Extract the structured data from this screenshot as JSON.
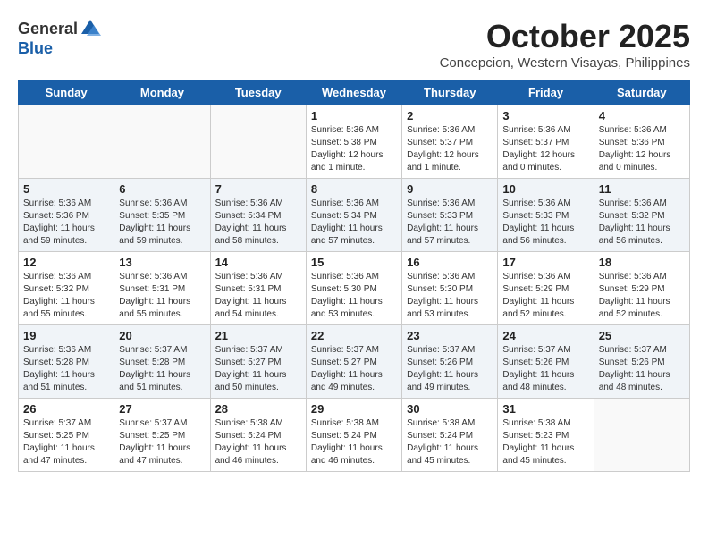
{
  "logo": {
    "general": "General",
    "blue": "Blue"
  },
  "title": "October 2025",
  "subtitle": "Concepcion, Western Visayas, Philippines",
  "headers": [
    "Sunday",
    "Monday",
    "Tuesday",
    "Wednesday",
    "Thursday",
    "Friday",
    "Saturday"
  ],
  "weeks": [
    {
      "shaded": false,
      "days": [
        {
          "number": "",
          "info": ""
        },
        {
          "number": "",
          "info": ""
        },
        {
          "number": "",
          "info": ""
        },
        {
          "number": "1",
          "info": "Sunrise: 5:36 AM\nSunset: 5:38 PM\nDaylight: 12 hours\nand 1 minute."
        },
        {
          "number": "2",
          "info": "Sunrise: 5:36 AM\nSunset: 5:37 PM\nDaylight: 12 hours\nand 1 minute."
        },
        {
          "number": "3",
          "info": "Sunrise: 5:36 AM\nSunset: 5:37 PM\nDaylight: 12 hours\nand 0 minutes."
        },
        {
          "number": "4",
          "info": "Sunrise: 5:36 AM\nSunset: 5:36 PM\nDaylight: 12 hours\nand 0 minutes."
        }
      ]
    },
    {
      "shaded": true,
      "days": [
        {
          "number": "5",
          "info": "Sunrise: 5:36 AM\nSunset: 5:36 PM\nDaylight: 11 hours\nand 59 minutes."
        },
        {
          "number": "6",
          "info": "Sunrise: 5:36 AM\nSunset: 5:35 PM\nDaylight: 11 hours\nand 59 minutes."
        },
        {
          "number": "7",
          "info": "Sunrise: 5:36 AM\nSunset: 5:34 PM\nDaylight: 11 hours\nand 58 minutes."
        },
        {
          "number": "8",
          "info": "Sunrise: 5:36 AM\nSunset: 5:34 PM\nDaylight: 11 hours\nand 57 minutes."
        },
        {
          "number": "9",
          "info": "Sunrise: 5:36 AM\nSunset: 5:33 PM\nDaylight: 11 hours\nand 57 minutes."
        },
        {
          "number": "10",
          "info": "Sunrise: 5:36 AM\nSunset: 5:33 PM\nDaylight: 11 hours\nand 56 minutes."
        },
        {
          "number": "11",
          "info": "Sunrise: 5:36 AM\nSunset: 5:32 PM\nDaylight: 11 hours\nand 56 minutes."
        }
      ]
    },
    {
      "shaded": false,
      "days": [
        {
          "number": "12",
          "info": "Sunrise: 5:36 AM\nSunset: 5:32 PM\nDaylight: 11 hours\nand 55 minutes."
        },
        {
          "number": "13",
          "info": "Sunrise: 5:36 AM\nSunset: 5:31 PM\nDaylight: 11 hours\nand 55 minutes."
        },
        {
          "number": "14",
          "info": "Sunrise: 5:36 AM\nSunset: 5:31 PM\nDaylight: 11 hours\nand 54 minutes."
        },
        {
          "number": "15",
          "info": "Sunrise: 5:36 AM\nSunset: 5:30 PM\nDaylight: 11 hours\nand 53 minutes."
        },
        {
          "number": "16",
          "info": "Sunrise: 5:36 AM\nSunset: 5:30 PM\nDaylight: 11 hours\nand 53 minutes."
        },
        {
          "number": "17",
          "info": "Sunrise: 5:36 AM\nSunset: 5:29 PM\nDaylight: 11 hours\nand 52 minutes."
        },
        {
          "number": "18",
          "info": "Sunrise: 5:36 AM\nSunset: 5:29 PM\nDaylight: 11 hours\nand 52 minutes."
        }
      ]
    },
    {
      "shaded": true,
      "days": [
        {
          "number": "19",
          "info": "Sunrise: 5:36 AM\nSunset: 5:28 PM\nDaylight: 11 hours\nand 51 minutes."
        },
        {
          "number": "20",
          "info": "Sunrise: 5:37 AM\nSunset: 5:28 PM\nDaylight: 11 hours\nand 51 minutes."
        },
        {
          "number": "21",
          "info": "Sunrise: 5:37 AM\nSunset: 5:27 PM\nDaylight: 11 hours\nand 50 minutes."
        },
        {
          "number": "22",
          "info": "Sunrise: 5:37 AM\nSunset: 5:27 PM\nDaylight: 11 hours\nand 49 minutes."
        },
        {
          "number": "23",
          "info": "Sunrise: 5:37 AM\nSunset: 5:26 PM\nDaylight: 11 hours\nand 49 minutes."
        },
        {
          "number": "24",
          "info": "Sunrise: 5:37 AM\nSunset: 5:26 PM\nDaylight: 11 hours\nand 48 minutes."
        },
        {
          "number": "25",
          "info": "Sunrise: 5:37 AM\nSunset: 5:26 PM\nDaylight: 11 hours\nand 48 minutes."
        }
      ]
    },
    {
      "shaded": false,
      "days": [
        {
          "number": "26",
          "info": "Sunrise: 5:37 AM\nSunset: 5:25 PM\nDaylight: 11 hours\nand 47 minutes."
        },
        {
          "number": "27",
          "info": "Sunrise: 5:37 AM\nSunset: 5:25 PM\nDaylight: 11 hours\nand 47 minutes."
        },
        {
          "number": "28",
          "info": "Sunrise: 5:38 AM\nSunset: 5:24 PM\nDaylight: 11 hours\nand 46 minutes."
        },
        {
          "number": "29",
          "info": "Sunrise: 5:38 AM\nSunset: 5:24 PM\nDaylight: 11 hours\nand 46 minutes."
        },
        {
          "number": "30",
          "info": "Sunrise: 5:38 AM\nSunset: 5:24 PM\nDaylight: 11 hours\nand 45 minutes."
        },
        {
          "number": "31",
          "info": "Sunrise: 5:38 AM\nSunset: 5:23 PM\nDaylight: 11 hours\nand 45 minutes."
        },
        {
          "number": "",
          "info": ""
        }
      ]
    }
  ]
}
